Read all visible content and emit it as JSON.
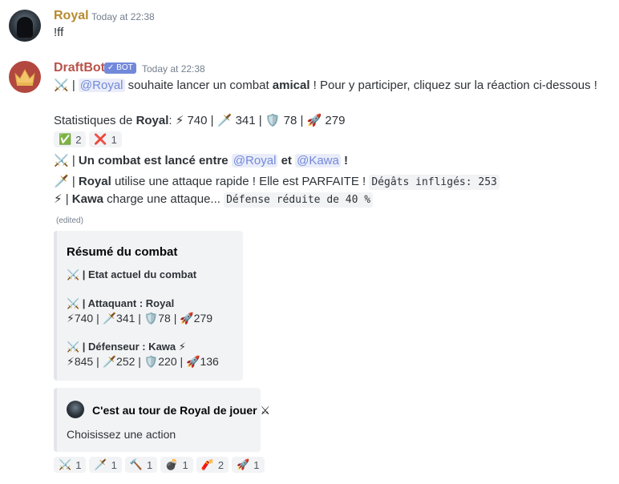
{
  "msg1": {
    "author": "Royal",
    "timestamp": "Today at 22:38",
    "text": "!ff"
  },
  "msg2": {
    "author": "DraftBot",
    "bot_tag": "✓ BOT",
    "timestamp": "Today at 22:38",
    "line1": {
      "icon": "⚔️",
      "sep": " | ",
      "mention": "@Royal",
      "t1": " souhaite lancer un combat ",
      "bold": "amical",
      "t2": " ! Pour y participer, cliquez sur la réaction ci-dessous !"
    },
    "line2": {
      "label": "Statistiques de ",
      "name": "Royal",
      "colon": ":",
      "stats": "⚡ 740 | 🗡️ 341 | 🛡️ 78 | 🚀 279"
    },
    "reactions1": [
      {
        "emoji": "✅",
        "count": "2"
      },
      {
        "emoji": "❌",
        "count": "1"
      }
    ],
    "line3": {
      "icon": "⚔️",
      "sep": " | ",
      "bold1": "Un combat est lancé entre ",
      "m1": "@Royal",
      "and": " et ",
      "m2": "@Kawa",
      "end": " !"
    },
    "line4": {
      "icon": "🗡️",
      "sep": " | ",
      "name": "Royal",
      "text": " utilise une attaque rapide ! Elle est PARFAITE ! ",
      "code": "Dégâts infligés: 253"
    },
    "line5": {
      "icon": "⚡",
      "sep": " | ",
      "name": "Kawa",
      "text": " charge une attaque... ",
      "code": "Défense réduite de 40 %"
    },
    "edited": "(edited)",
    "embed1": {
      "title": "Résumé du combat",
      "state": "⚔️ | Etat actuel du combat",
      "attacker": "⚔️ | Attaquant : Royal",
      "attacker_stats": "⚡740 | 🗡️341 | 🛡️78 | 🚀279",
      "defender": "⚔️ | Défenseur : Kawa ⚡",
      "defender_stats": "⚡845 | 🗡️252 | 🛡️220 | 🚀136"
    },
    "embed2": {
      "author": "C'est au tour de Royal de jouer ⚔",
      "description": "Choisissez une action"
    },
    "reactions2": [
      {
        "emoji": "⚔️",
        "count": "1"
      },
      {
        "emoji": "🗡️",
        "count": "1"
      },
      {
        "emoji": "🔨",
        "count": "1"
      },
      {
        "emoji": "💣",
        "count": "1"
      },
      {
        "emoji": "🧨",
        "count": "2"
      },
      {
        "emoji": "🚀",
        "count": "1"
      }
    ]
  }
}
